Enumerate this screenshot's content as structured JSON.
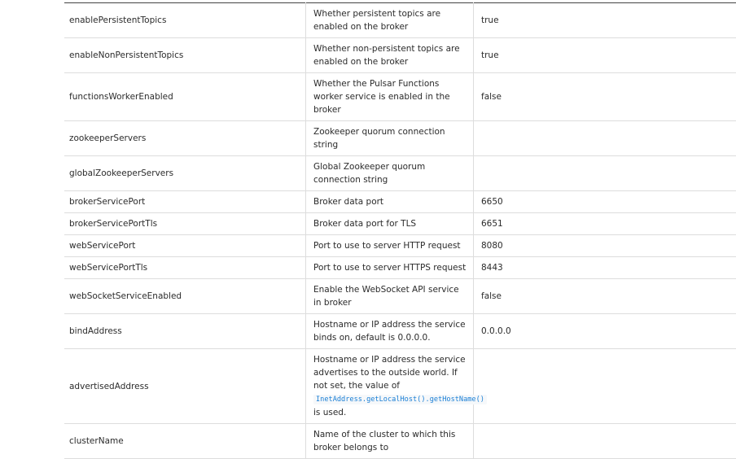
{
  "rows": [
    {
      "name": "enablePersistentTopics",
      "description": "Whether persistent topics are enabled on the broker",
      "default": "true"
    },
    {
      "name": "enableNonPersistentTopics",
      "description": "Whether non-persistent topics are enabled on the broker",
      "default": "true"
    },
    {
      "name": "functionsWorkerEnabled",
      "description": "Whether the Pulsar Functions worker service is enabled in the broker",
      "default": "false"
    },
    {
      "name": "zookeeperServers",
      "description": "Zookeeper quorum connection string",
      "default": ""
    },
    {
      "name": "globalZookeeperServers",
      "description": "Global Zookeeper quorum connection string",
      "default": ""
    },
    {
      "name": "brokerServicePort",
      "description": "Broker data port",
      "default": "6650"
    },
    {
      "name": "brokerServicePortTls",
      "description": "Broker data port for TLS",
      "default": "6651"
    },
    {
      "name": "webServicePort",
      "description": "Port to use to server HTTP request",
      "default": "8080"
    },
    {
      "name": "webServicePortTls",
      "description": "Port to use to server HTTPS request",
      "default": "8443"
    },
    {
      "name": "webSocketServiceEnabled",
      "description": "Enable the WebSocket API service in broker",
      "default": "false"
    },
    {
      "name": "bindAddress",
      "description": "Hostname or IP address the service binds on, default is 0.0.0.0.",
      "default": "0.0.0.0"
    },
    {
      "name": "advertisedAddress",
      "description_pre": "Hostname or IP address the service advertises to the outside world. If not set, the value of",
      "description_code": "InetAddress.getLocalHost().getHostName()",
      "description_post": "is used.",
      "default": ""
    },
    {
      "name": "clusterName",
      "description": "Name of the cluster to which this broker belongs to",
      "default": ""
    }
  ]
}
